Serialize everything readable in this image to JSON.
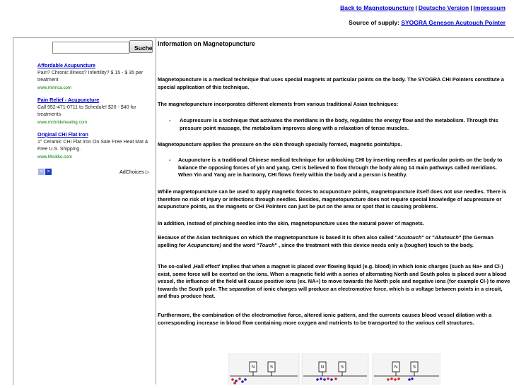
{
  "top_links": {
    "back": "Back to Magnetopuncture",
    "separator": "|",
    "german": "Deutsche Version",
    "imprint": "Impressum"
  },
  "supply": {
    "label": "Source of supply:",
    "link": "SYOGRA Genesen Acutouch Pointer"
  },
  "search": {
    "value": "",
    "button_label": "Suche"
  },
  "ads": [
    {
      "title": "Affordable Acupuncture",
      "text": "Pain? Chronic Illness? Infertility? $ 15 - $ 35 per treatment",
      "url": "www.minnca.com"
    },
    {
      "title": "Pain Relief - Acupuncture",
      "text": "Call 952-471-0711 to Schedule! $20 - $40 for treatments",
      "url": "www.mcbridehealing.com"
    },
    {
      "title": "Original CHI Flat Iron",
      "text": "1\" Ceramic CHI Flat Iron On Sale Free Heat Mat & Free U.S. Shipping.",
      "url": "www.Misikko.com"
    }
  ],
  "ad_nav": {
    "prev": "<",
    "next": ">"
  },
  "adchoices": "AdChoices ▷",
  "content": {
    "title": "Information on Magnetopuncture",
    "p1": "Magnetopuncture is a medical technique that uses special magnets at particular points on the body. The SYOGRA CHI Pointers constitute a special application of this technique.",
    "p2": "The magnetopuncture incorporates different elements from various traditional Asian techniques:",
    "bullet1": "Acupressure is a technique that activates the meridians in the body, regulates the energy flow and the metabolism. Through this pressure point massage, the metabolism improves along with a relaxation of tense muscles.",
    "p3": "Magnetopuncture applies the pressure on the skin through specially formed, magnetic points/tips.",
    "bullet2": "Acupuncture is a traditional Chinese medical technique for unblocking CHI by inserting needles at particular points on the body to balance the opposing forces of yin and yang. CHI is believed to flow through the body along 14 main pathways called meridians.  When Yin and Yang are in harmony, CHI flows freely within the body and a person is healthy.",
    "p4": "While magnetopuncture can be used to apply magnetic forces to acupuncture points, magnetopuncture itself does not use needles. There is therefore no risk of injury or infections through needles. Besides, magnetopuncture does not require special knowledge of acupressure or acupuncture points, as the magnets or CHI Pointers can just be put on the area or spot that is causing problems.",
    "p5": "In addition, instead of pinching needles into the skin, magnetopuncture uses the natural power of magnets.",
    "p6_a": "Because of the Asian techniques on which the magnetopuncture is based it is often also called \"",
    "p6_acutouch": "Acutouch",
    "p6_b": "\" or \"",
    "p6_akutouch": "Akutouch",
    "p6_c": "\" (the German spelling for ",
    "p6_acupuncture": "Acupuncture)",
    "p6_d": " and the word \"",
    "p6_touch": "Touch",
    "p6_e": "\" , since the treatment with this device needs only a (tougher) touch to the body.",
    "p7": "The so-called ‚Hall effect' implies that when a magnet is placed over flowing liquid (e.g. blood) in which ionic charges (such as Na+ and Cl-) exist, some force will be exerted on the ions. When a magnetic field with a series of alternating North and South poles is placed over a blood vessel, the influence of the field will cause positive ions (ex. NA+) to move towards the North pole and negative ions (for example Cl-) to move towards the South pole. The separation of ionic charges will produce an electromotive force, which is a voltage between points in a circuit, and thus produce heat.",
    "p8": "Furthermore, the combination of the electromotive force, altered ionic pattern, and the currents causes blood vessel dilation with a corresponding increase in blood flow containing more oxygen and nutrients to be transported to the various cell structures."
  },
  "diagram": {
    "north": "N",
    "south": "S"
  }
}
